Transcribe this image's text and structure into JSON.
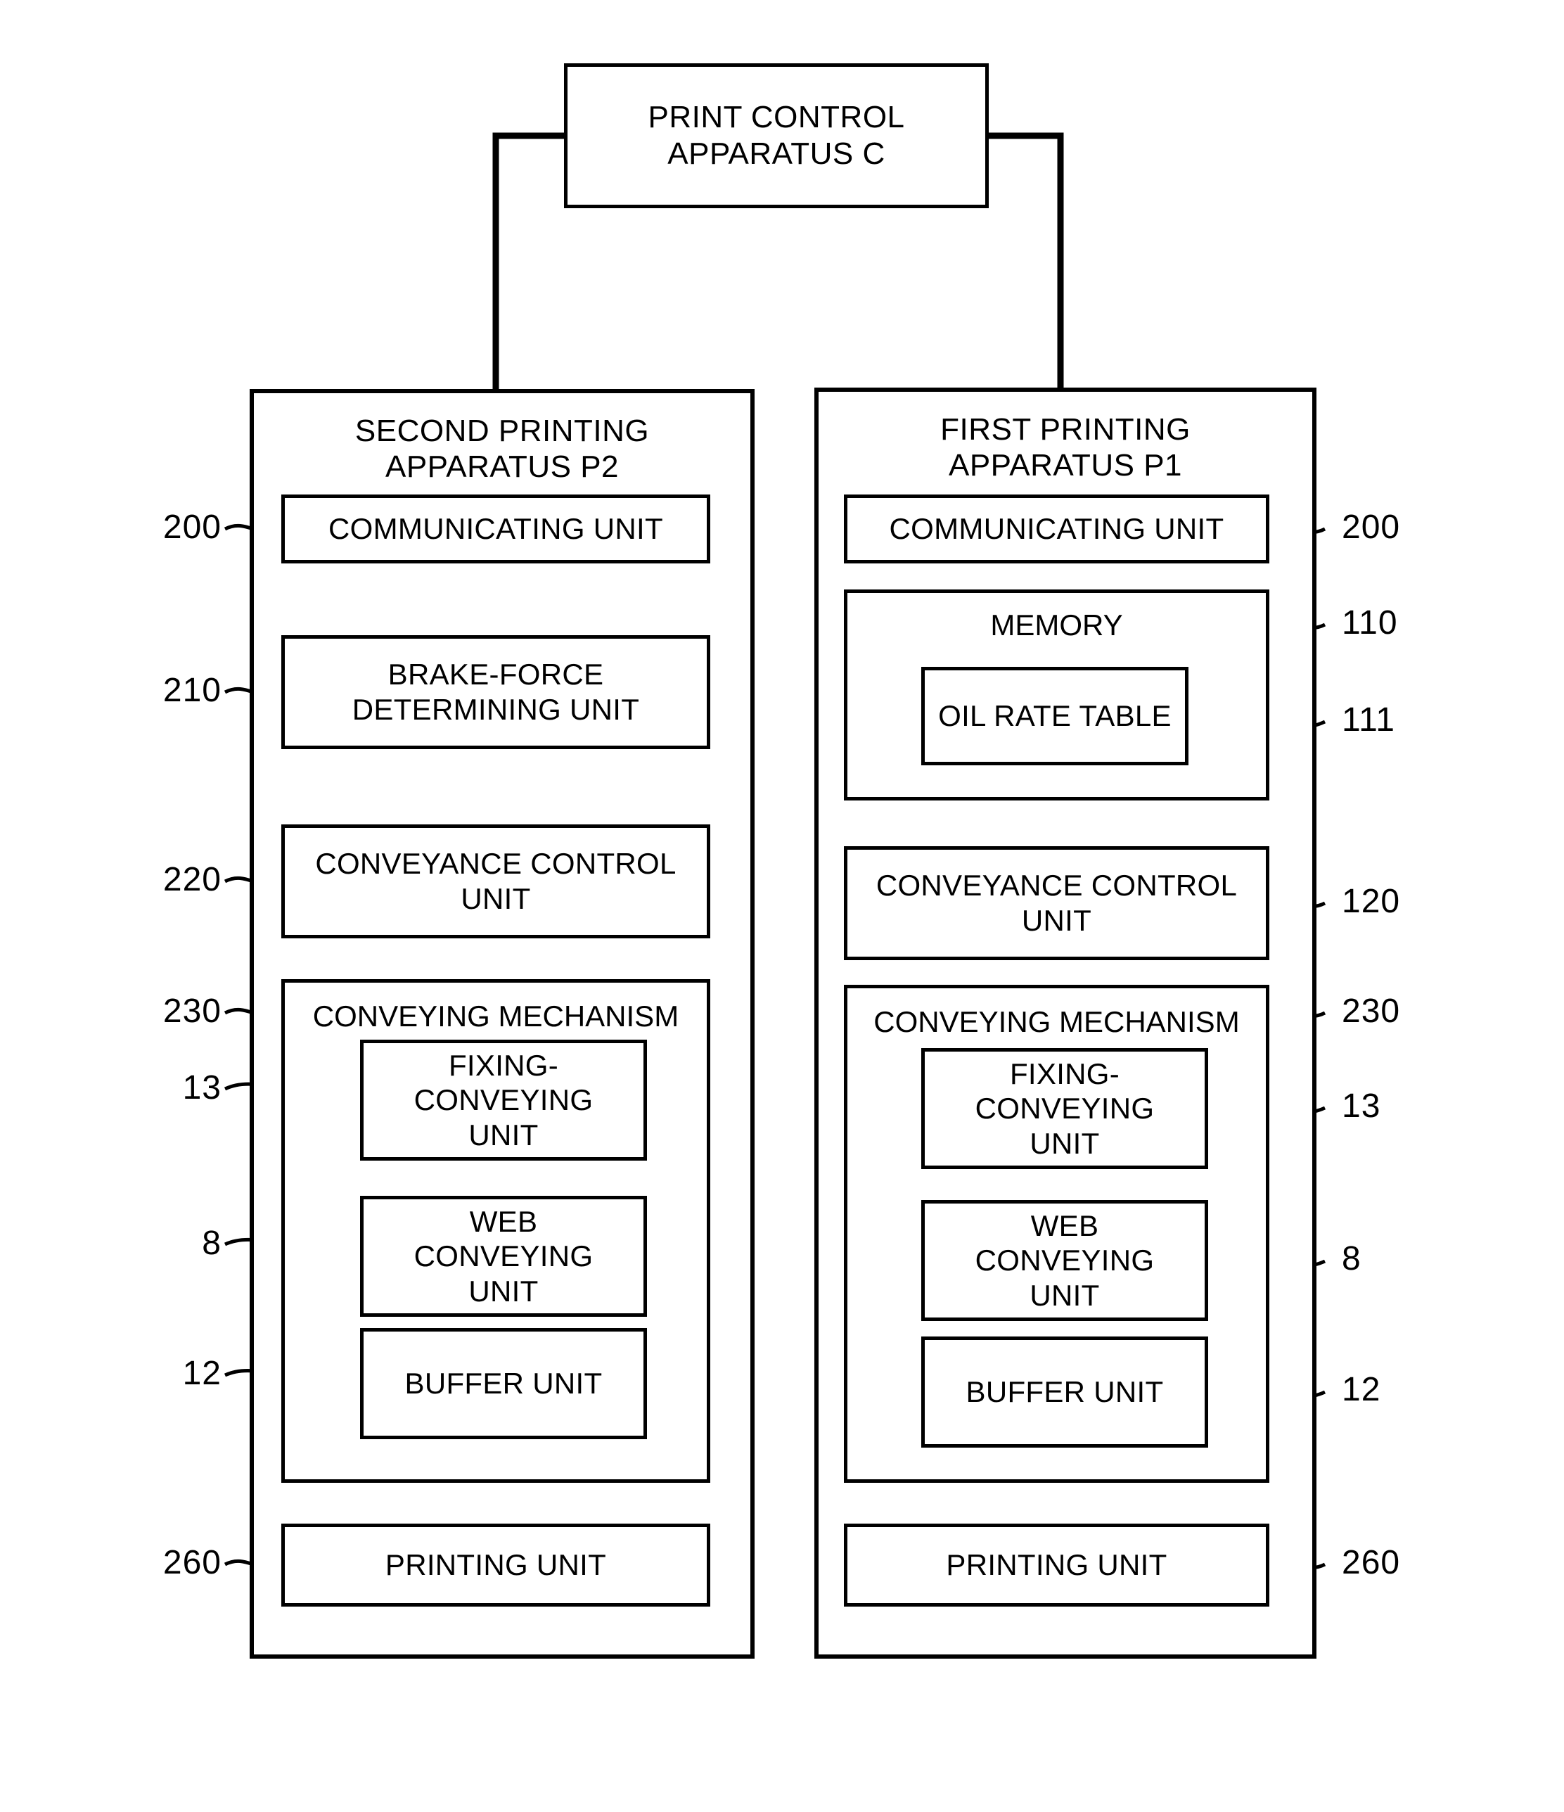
{
  "figure": {
    "type": "patent-block-diagram",
    "title_box": {
      "label": "PRINT CONTROL\nAPPARATUS C",
      "line1": "PRINT CONTROL",
      "line2": "APPARATUS C"
    }
  },
  "panels": [
    {
      "id": "second-printing-apparatus",
      "title_line1": "SECOND PRINTING",
      "title_line2": "APPARATUS P2",
      "blocks": [
        {
          "id": "communicating-unit",
          "label": "COMMUNICATING UNIT",
          "ref": "200"
        },
        {
          "id": "brake-force-determining-unit",
          "line1": "BRAKE-FORCE",
          "line2": "DETERMINING UNIT",
          "ref": "210"
        },
        {
          "id": "conveyance-control-unit",
          "line1": "CONVEYANCE CONTROL",
          "line2": "UNIT",
          "ref": "220"
        },
        {
          "id": "conveying-mechanism",
          "label": "CONVEYING MECHANISM",
          "ref": "230",
          "children": [
            {
              "id": "fixing-conveying-unit",
              "line1": "FIXING-",
              "line2": "CONVEYING",
              "line3": "UNIT",
              "ref": "13"
            },
            {
              "id": "web-conveying-unit",
              "line1": "WEB",
              "line2": "CONVEYING",
              "line3": "UNIT",
              "ref": "8"
            },
            {
              "id": "buffer-unit",
              "label": "BUFFER UNIT",
              "ref": "12"
            }
          ]
        },
        {
          "id": "printing-unit",
          "label": "PRINTING UNIT",
          "ref": "260"
        }
      ]
    },
    {
      "id": "first-printing-apparatus",
      "title_line1": "FIRST PRINTING",
      "title_line2": "APPARATUS P1",
      "blocks": [
        {
          "id": "communicating-unit",
          "label": "COMMUNICATING UNIT",
          "ref": "200"
        },
        {
          "id": "memory",
          "label": "MEMORY",
          "ref": "110",
          "children": [
            {
              "id": "oil-rate-table",
              "label": "OIL RATE TABLE",
              "ref": "111"
            }
          ]
        },
        {
          "id": "conveyance-control-unit",
          "line1": "CONVEYANCE CONTROL",
          "line2": "UNIT",
          "ref": "120"
        },
        {
          "id": "conveying-mechanism",
          "label": "CONVEYING MECHANISM",
          "ref": "230",
          "children": [
            {
              "id": "fixing-conveying-unit",
              "line1": "FIXING-",
              "line2": "CONVEYING",
              "line3": "UNIT",
              "ref": "13"
            },
            {
              "id": "web-conveying-unit",
              "line1": "WEB",
              "line2": "CONVEYING",
              "line3": "UNIT",
              "ref": "8"
            },
            {
              "id": "buffer-unit",
              "label": "BUFFER UNIT",
              "ref": "12"
            }
          ]
        },
        {
          "id": "printing-unit",
          "label": "PRINTING UNIT",
          "ref": "260"
        }
      ]
    }
  ],
  "colors": {
    "line": "#000000",
    "fill": "#ffffff"
  }
}
